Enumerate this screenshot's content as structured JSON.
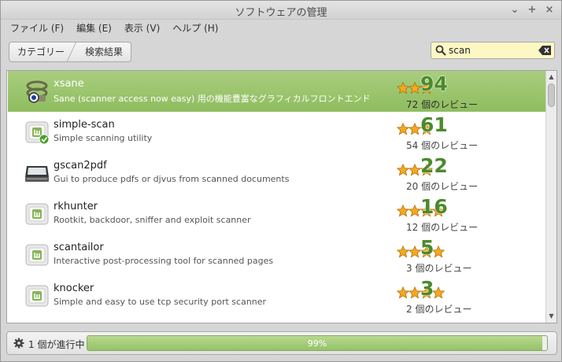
{
  "window": {
    "title": "ソフトウェアの管理",
    "controls": [
      "⌄",
      "+",
      "×"
    ]
  },
  "menu": [
    {
      "label": "ファイル (F)"
    },
    {
      "label": "編集 (E)"
    },
    {
      "label": "表示 (V)"
    },
    {
      "label": "ヘルプ (H)"
    }
  ],
  "breadcrumb": {
    "items": [
      "カテゴリー",
      "検索結果"
    ]
  },
  "search": {
    "value": "scan",
    "placeholder": ""
  },
  "packages": [
    {
      "name": "xsane",
      "description": "Sane (scanner access now easy) 用の機能豊富なグラフィカルフロントエンド",
      "score": "94",
      "reviews": "72 個のレビュー",
      "stars": 3,
      "icon": "scanner-app-icon",
      "installed": false,
      "selected": true
    },
    {
      "name": "simple-scan",
      "description": "Simple scanning utility",
      "score": "61",
      "reviews": "54 個のレビュー",
      "stars": 3,
      "icon": "mint-package-icon",
      "installed": true,
      "selected": false
    },
    {
      "name": "gscan2pdf",
      "description": "Gui to produce pdfs or djvus from scanned documents",
      "score": "22",
      "reviews": "20 個のレビュー",
      "stars": 3,
      "icon": "flatbed-scanner-icon",
      "installed": false,
      "selected": false
    },
    {
      "name": "rkhunter",
      "description": "Rootkit, backdoor, sniffer and exploit scanner",
      "score": "16",
      "reviews": "12 個のレビュー",
      "stars": 4,
      "icon": "mint-package-icon",
      "installed": false,
      "selected": false
    },
    {
      "name": "scantailor",
      "description": "Interactive post-processing tool for scanned pages",
      "score": "5",
      "reviews": "3 個のレビュー",
      "stars": 4,
      "icon": "mint-package-icon",
      "installed": false,
      "selected": false
    },
    {
      "name": "knocker",
      "description": "Simple and easy to use tcp security port scanner",
      "score": "3",
      "reviews": "2 個のレビュー",
      "stars": 4,
      "icon": "mint-package-icon",
      "installed": false,
      "selected": false
    }
  ],
  "status": {
    "text": "1 個が進行中",
    "progress": 0.99,
    "progress_label": "99%"
  },
  "colors": {
    "accent": "#8fbd5f",
    "search_bg": "#fdf7c4",
    "score": "#4b8a2d"
  }
}
